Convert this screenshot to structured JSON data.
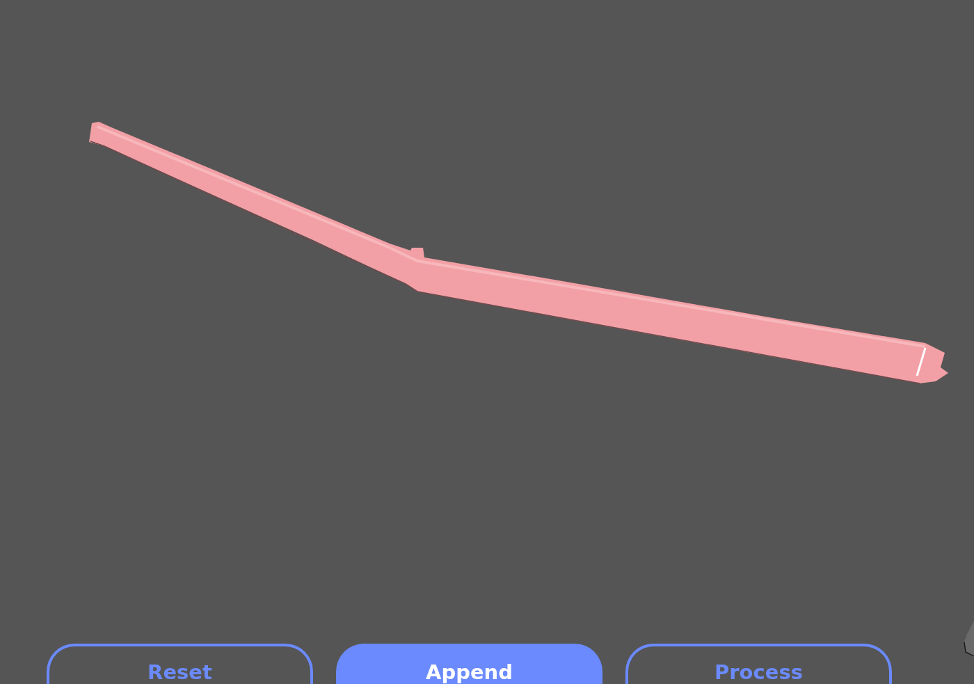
{
  "buttons": [
    {
      "label": "Reset",
      "kind": "outline"
    },
    {
      "label": "Append",
      "kind": "filled"
    },
    {
      "label": "Process",
      "kind": "outline"
    }
  ]
}
